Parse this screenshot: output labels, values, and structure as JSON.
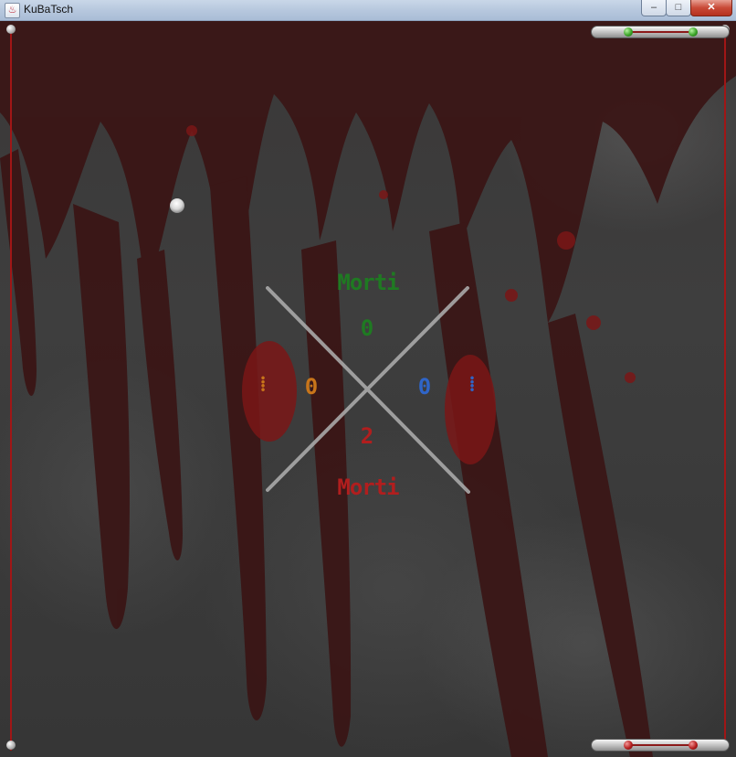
{
  "window": {
    "title": "KuBaTsch",
    "minimize_label": "–",
    "maximize_label": "□",
    "close_label": "✕"
  },
  "icons": {
    "app": "java-icon",
    "minimize": "minimize-icon",
    "maximize": "maximize-icon",
    "close": "close-icon"
  },
  "game": {
    "player_top": {
      "name": "Morti",
      "score": "0",
      "color": "#1f7a22"
    },
    "player_bottom": {
      "name": "Morti",
      "score": "2",
      "color": "#b11e1e"
    },
    "player_left": {
      "score": "0",
      "marker": "⁞",
      "color": "#c8751a"
    },
    "player_right": {
      "score": "0",
      "marker": "⁞",
      "color": "#2f65c8"
    },
    "paddle_top": {
      "knob_color": "green"
    },
    "paddle_bottom": {
      "knob_color": "red"
    },
    "accent": "#a01616"
  }
}
